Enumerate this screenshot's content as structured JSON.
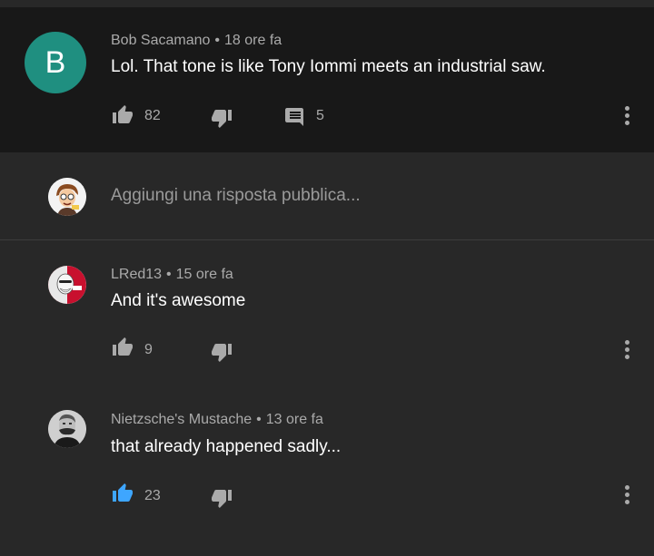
{
  "colors": {
    "like_active": "#3ea6ff",
    "icon_gray": "#aaaaaa",
    "avatar_b": "#1f8f80"
  },
  "comments": [
    {
      "author": "Bob Sacamano",
      "time": "18 ore fa",
      "text": "Lol. That tone is like Tony Iommi meets an industrial saw.",
      "likes": "82",
      "replies": "5",
      "avatar_letter": "B",
      "liked": false
    },
    {
      "author": "LRed13",
      "time": "15 ore fa",
      "text": "And it's awesome",
      "likes": "9",
      "liked": false
    },
    {
      "author": "Nietzsche's Mustache",
      "time": "13 ore fa",
      "text": "that already happened sadly...",
      "likes": "23",
      "liked": true
    }
  ],
  "reply": {
    "placeholder": "Aggiungi una risposta pubblica..."
  },
  "separator": "•",
  "icons": [
    "thumbs-up-icon",
    "thumbs-down-icon",
    "reply-comment-icon",
    "more-vert-icon"
  ]
}
